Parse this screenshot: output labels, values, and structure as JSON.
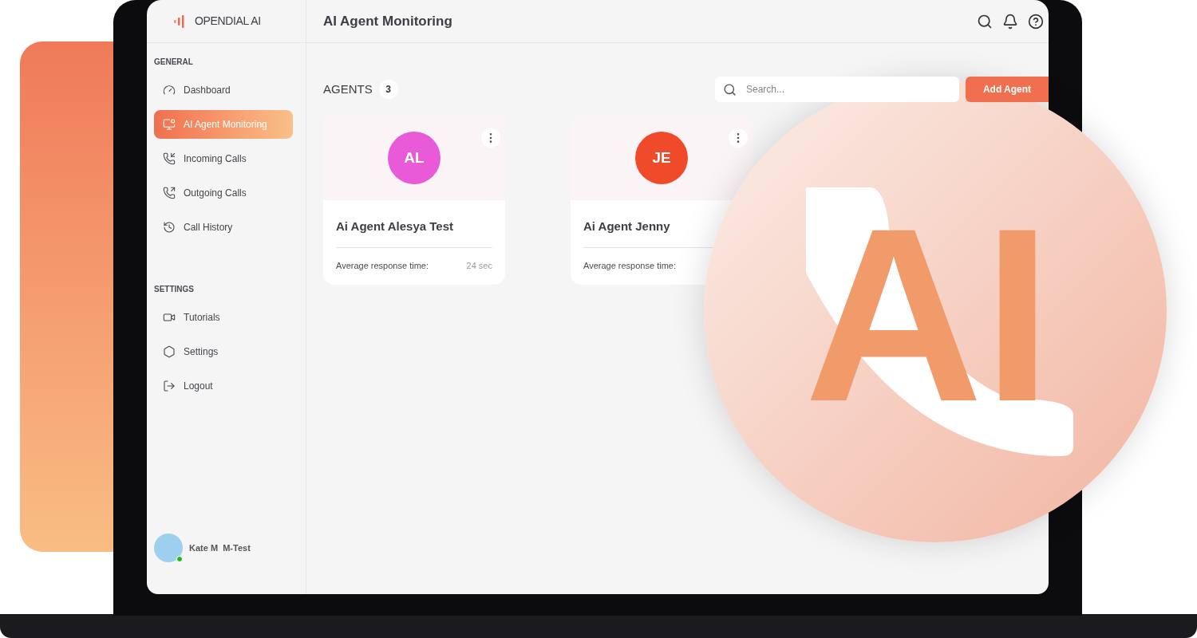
{
  "brand": {
    "name": "OPENDIAL AI"
  },
  "header": {
    "title": "AI Agent Monitoring"
  },
  "sidebar": {
    "sections": [
      {
        "heading": "GENERAL",
        "items": [
          {
            "label": "Dashboard",
            "selected": false
          },
          {
            "label": "AI Agent Monitoring",
            "selected": true
          },
          {
            "label": "Incoming Calls",
            "selected": false
          },
          {
            "label": "Outgoing Calls",
            "selected": false
          },
          {
            "label": "Call History",
            "selected": false
          }
        ]
      },
      {
        "heading": "SETTINGS",
        "items": [
          {
            "label": "Tutorials",
            "selected": false
          },
          {
            "label": "Settings",
            "selected": false
          },
          {
            "label": "Logout",
            "selected": false
          }
        ]
      }
    ],
    "user": {
      "name": "Kate M  M-Test",
      "online": true
    }
  },
  "agents": {
    "heading": "AGENTS",
    "count": "3",
    "search": {
      "placeholder": "Search..."
    },
    "add_button": "Add Agent",
    "cards": [
      {
        "initials": "AL",
        "name": "Ai Agent Alesya Test",
        "metric_label": "Average response time:",
        "metric_value": "24 sec",
        "color": "#e85ad8"
      },
      {
        "initials": "JE",
        "name": "Ai Agent Jenny",
        "metric_label": "Average response time:",
        "color": "#ef4a2a"
      }
    ]
  },
  "overlay_badge": {
    "text": "AI"
  }
}
